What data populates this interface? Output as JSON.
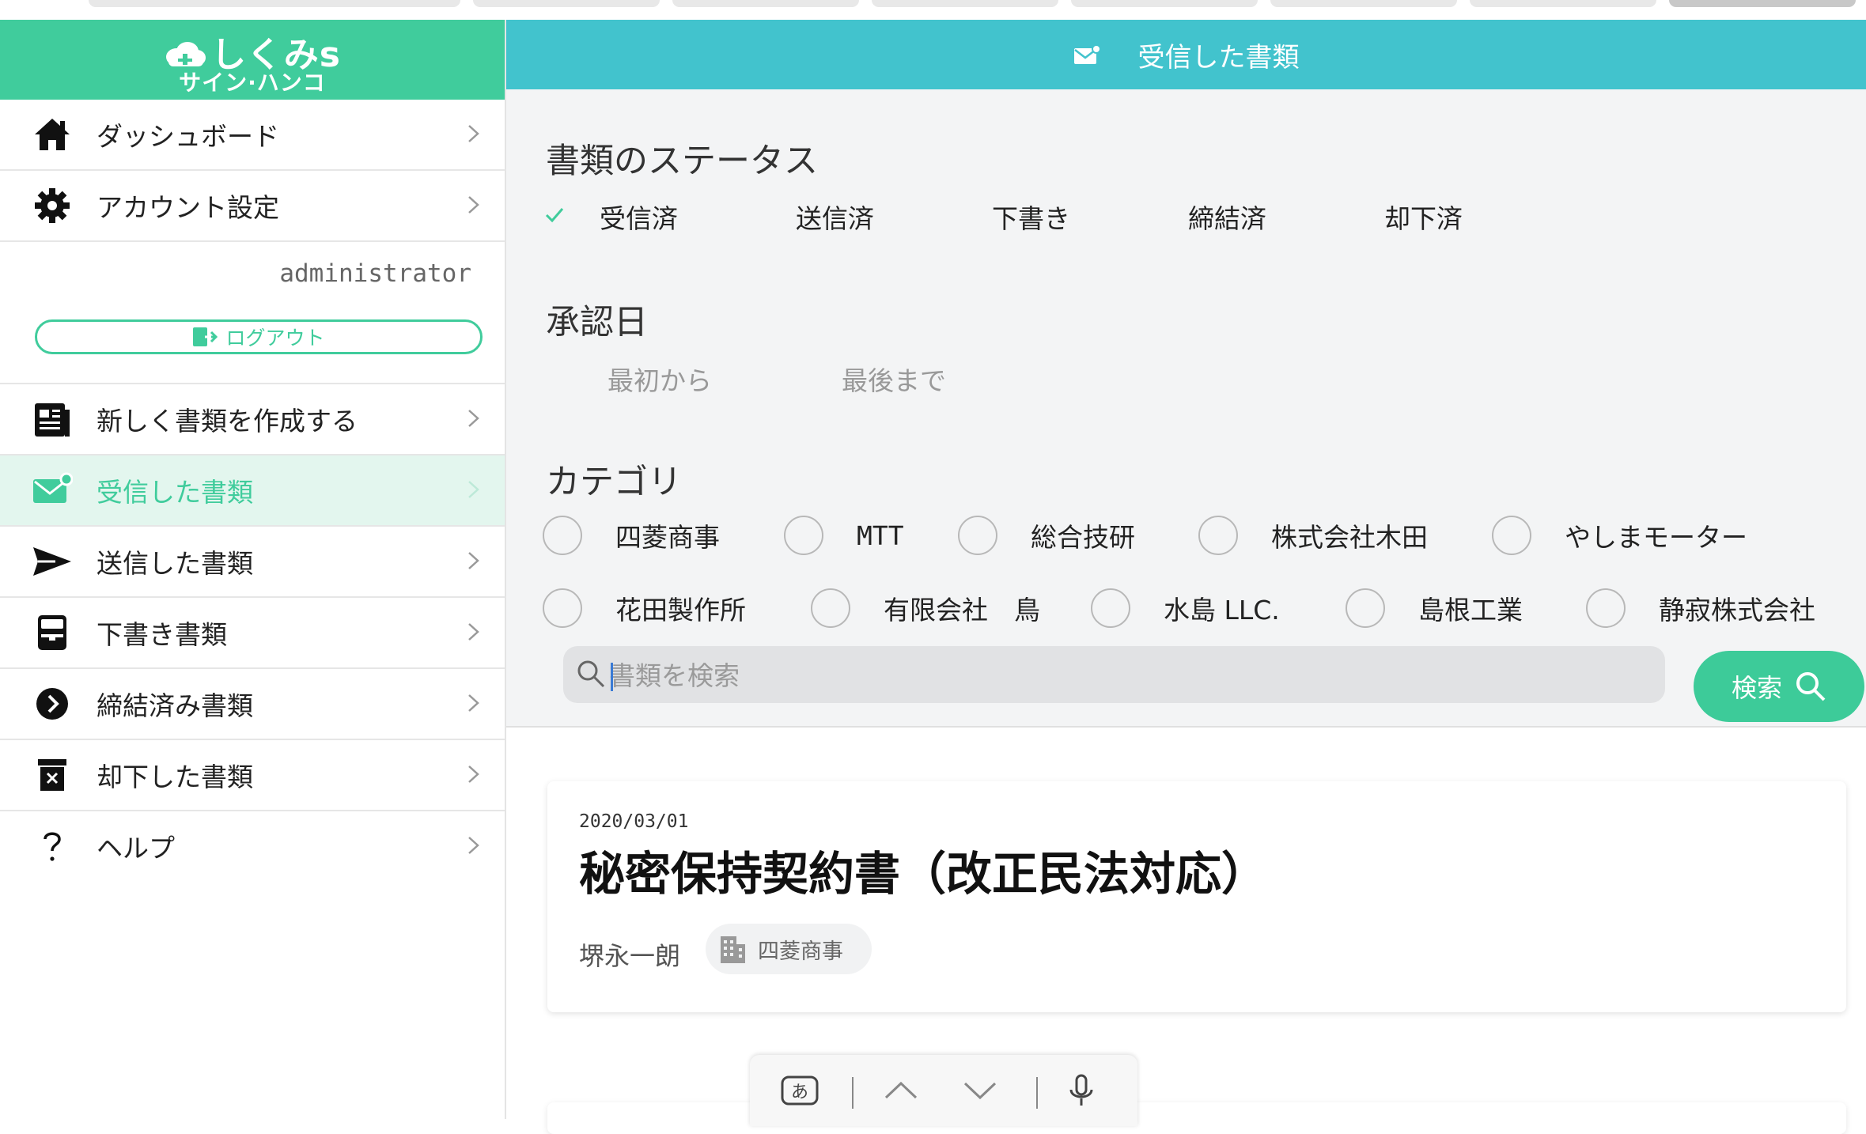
{
  "app": {
    "logo_main": "しくみs",
    "logo_sub": "サイン·ハンコ",
    "accent_color": "#40cc9c",
    "header_color": "#42c3cd"
  },
  "sidebar": {
    "top_items": [
      {
        "label": "ダッシュボード",
        "icon": "home-icon"
      },
      {
        "label": "アカウント設定",
        "icon": "gear-icon"
      }
    ],
    "user_name": "administrator",
    "logout_label": "ログアウト",
    "doc_items": [
      {
        "label": "新しく書類を作成する",
        "icon": "document-icon"
      },
      {
        "label": "受信した書類",
        "icon": "mail-icon",
        "active": true
      },
      {
        "label": "送信した書類",
        "icon": "send-icon"
      },
      {
        "label": "下書き書類",
        "icon": "inbox-tray-icon"
      },
      {
        "label": "締結済み書類",
        "icon": "chevron-circle-icon"
      },
      {
        "label": "却下した書類",
        "icon": "trash-icon"
      }
    ],
    "help_label": "ヘルプ"
  },
  "header": {
    "title": "受信した書類",
    "icon": "mail-icon"
  },
  "filters": {
    "status_title": "書類のステータス",
    "statuses": [
      "受信済",
      "送信済",
      "下書き",
      "締結済",
      "却下済"
    ],
    "selected_status": "受信済",
    "date_title": "承認日",
    "date_from_placeholder": "最初から",
    "date_to_placeholder": "最後まで",
    "category_title": "カテゴリ",
    "categories_row1": [
      "四菱商事",
      "MTT",
      "総合技研",
      "株式会社木田",
      "やしまモーター"
    ],
    "categories_row2": [
      "花田製作所",
      "有限会社　鳥",
      "水島 LLC.",
      "島根工業",
      "静寂株式会社"
    ],
    "search_placeholder": "書類を検索",
    "search_button": "検索"
  },
  "results": [
    {
      "date": "2020/03/01",
      "title": "秘密保持契約書（改正民法対応）",
      "person": "堺永一朗",
      "company": "四菱商事"
    }
  ],
  "keyboard_bar": {
    "ime_label": "あ"
  }
}
